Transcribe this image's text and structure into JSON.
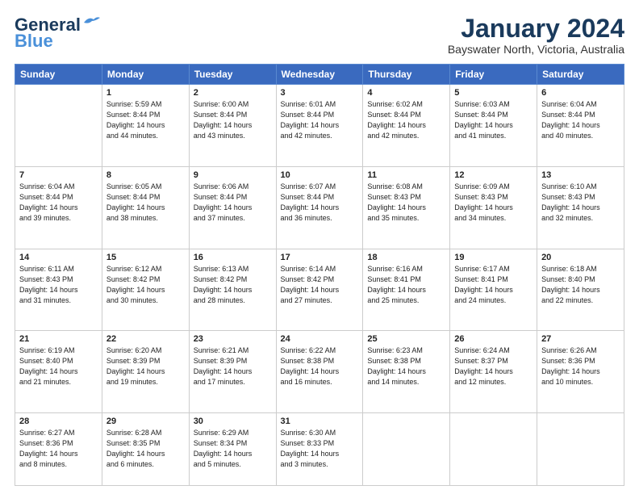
{
  "logo": {
    "line1": "General",
    "line2": "Blue",
    "bird": "🐦"
  },
  "header": {
    "month": "January 2024",
    "location": "Bayswater North, Victoria, Australia"
  },
  "weekdays": [
    "Sunday",
    "Monday",
    "Tuesday",
    "Wednesday",
    "Thursday",
    "Friday",
    "Saturday"
  ],
  "weeks": [
    [
      {
        "day": "",
        "info": ""
      },
      {
        "day": "1",
        "info": "Sunrise: 5:59 AM\nSunset: 8:44 PM\nDaylight: 14 hours\nand 44 minutes."
      },
      {
        "day": "2",
        "info": "Sunrise: 6:00 AM\nSunset: 8:44 PM\nDaylight: 14 hours\nand 43 minutes."
      },
      {
        "day": "3",
        "info": "Sunrise: 6:01 AM\nSunset: 8:44 PM\nDaylight: 14 hours\nand 42 minutes."
      },
      {
        "day": "4",
        "info": "Sunrise: 6:02 AM\nSunset: 8:44 PM\nDaylight: 14 hours\nand 42 minutes."
      },
      {
        "day": "5",
        "info": "Sunrise: 6:03 AM\nSunset: 8:44 PM\nDaylight: 14 hours\nand 41 minutes."
      },
      {
        "day": "6",
        "info": "Sunrise: 6:04 AM\nSunset: 8:44 PM\nDaylight: 14 hours\nand 40 minutes."
      }
    ],
    [
      {
        "day": "7",
        "info": "Sunrise: 6:04 AM\nSunset: 8:44 PM\nDaylight: 14 hours\nand 39 minutes."
      },
      {
        "day": "8",
        "info": "Sunrise: 6:05 AM\nSunset: 8:44 PM\nDaylight: 14 hours\nand 38 minutes."
      },
      {
        "day": "9",
        "info": "Sunrise: 6:06 AM\nSunset: 8:44 PM\nDaylight: 14 hours\nand 37 minutes."
      },
      {
        "day": "10",
        "info": "Sunrise: 6:07 AM\nSunset: 8:44 PM\nDaylight: 14 hours\nand 36 minutes."
      },
      {
        "day": "11",
        "info": "Sunrise: 6:08 AM\nSunset: 8:43 PM\nDaylight: 14 hours\nand 35 minutes."
      },
      {
        "day": "12",
        "info": "Sunrise: 6:09 AM\nSunset: 8:43 PM\nDaylight: 14 hours\nand 34 minutes."
      },
      {
        "day": "13",
        "info": "Sunrise: 6:10 AM\nSunset: 8:43 PM\nDaylight: 14 hours\nand 32 minutes."
      }
    ],
    [
      {
        "day": "14",
        "info": "Sunrise: 6:11 AM\nSunset: 8:43 PM\nDaylight: 14 hours\nand 31 minutes."
      },
      {
        "day": "15",
        "info": "Sunrise: 6:12 AM\nSunset: 8:42 PM\nDaylight: 14 hours\nand 30 minutes."
      },
      {
        "day": "16",
        "info": "Sunrise: 6:13 AM\nSunset: 8:42 PM\nDaylight: 14 hours\nand 28 minutes."
      },
      {
        "day": "17",
        "info": "Sunrise: 6:14 AM\nSunset: 8:42 PM\nDaylight: 14 hours\nand 27 minutes."
      },
      {
        "day": "18",
        "info": "Sunrise: 6:16 AM\nSunset: 8:41 PM\nDaylight: 14 hours\nand 25 minutes."
      },
      {
        "day": "19",
        "info": "Sunrise: 6:17 AM\nSunset: 8:41 PM\nDaylight: 14 hours\nand 24 minutes."
      },
      {
        "day": "20",
        "info": "Sunrise: 6:18 AM\nSunset: 8:40 PM\nDaylight: 14 hours\nand 22 minutes."
      }
    ],
    [
      {
        "day": "21",
        "info": "Sunrise: 6:19 AM\nSunset: 8:40 PM\nDaylight: 14 hours\nand 21 minutes."
      },
      {
        "day": "22",
        "info": "Sunrise: 6:20 AM\nSunset: 8:39 PM\nDaylight: 14 hours\nand 19 minutes."
      },
      {
        "day": "23",
        "info": "Sunrise: 6:21 AM\nSunset: 8:39 PM\nDaylight: 14 hours\nand 17 minutes."
      },
      {
        "day": "24",
        "info": "Sunrise: 6:22 AM\nSunset: 8:38 PM\nDaylight: 14 hours\nand 16 minutes."
      },
      {
        "day": "25",
        "info": "Sunrise: 6:23 AM\nSunset: 8:38 PM\nDaylight: 14 hours\nand 14 minutes."
      },
      {
        "day": "26",
        "info": "Sunrise: 6:24 AM\nSunset: 8:37 PM\nDaylight: 14 hours\nand 12 minutes."
      },
      {
        "day": "27",
        "info": "Sunrise: 6:26 AM\nSunset: 8:36 PM\nDaylight: 14 hours\nand 10 minutes."
      }
    ],
    [
      {
        "day": "28",
        "info": "Sunrise: 6:27 AM\nSunset: 8:36 PM\nDaylight: 14 hours\nand 8 minutes."
      },
      {
        "day": "29",
        "info": "Sunrise: 6:28 AM\nSunset: 8:35 PM\nDaylight: 14 hours\nand 6 minutes."
      },
      {
        "day": "30",
        "info": "Sunrise: 6:29 AM\nSunset: 8:34 PM\nDaylight: 14 hours\nand 5 minutes."
      },
      {
        "day": "31",
        "info": "Sunrise: 6:30 AM\nSunset: 8:33 PM\nDaylight: 14 hours\nand 3 minutes."
      },
      {
        "day": "",
        "info": ""
      },
      {
        "day": "",
        "info": ""
      },
      {
        "day": "",
        "info": ""
      }
    ]
  ]
}
